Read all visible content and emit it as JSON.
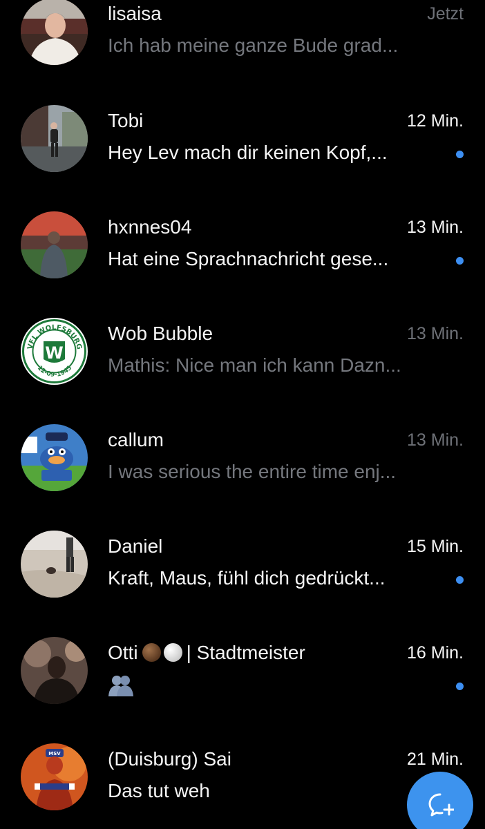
{
  "conversations": [
    {
      "name": "lisaisa",
      "time": "Jetzt",
      "preview": "Ich hab meine ganze Bude grad...",
      "unread": false,
      "avatar_icon": "man-in-stadium-avatar"
    },
    {
      "name": "Tobi",
      "time": "12 Min.",
      "preview": "Hey Lev mach dir keinen Kopf,...",
      "unread": true,
      "avatar_icon": "man-walking-street-avatar"
    },
    {
      "name": "hxnnes04",
      "time": "13 Min.",
      "preview": "Hat eine Sprachnachricht gese...",
      "unread": true,
      "avatar_icon": "man-in-stadium-crowd-avatar"
    },
    {
      "name": "Wob Bubble",
      "time": "13 Min.",
      "preview": "Mathis: Nice man ich kann Dazn...",
      "unread": false,
      "avatar_icon": "vfl-wolfsburg-logo-avatar",
      "avatar_text": {
        "top": "VFL WOLFSBURG",
        "bottom": "12-09-1945",
        "letter": "W"
      }
    },
    {
      "name": "callum",
      "time": "13 Min.",
      "preview": "I was serious the entire time enj...",
      "unread": false,
      "avatar_icon": "cartoon-fan-avatar"
    },
    {
      "name": "Daniel",
      "time": "15 Min.",
      "preview": "Kraft, Maus, fühl dich gedrückt...",
      "unread": true,
      "avatar_icon": "beach-dog-avatar"
    },
    {
      "name": "Otti",
      "name_suffix": "| Stadtmeister",
      "time": "16 Min.",
      "preview": "",
      "unread": true,
      "avatar_icon": "man-in-dark-avatar",
      "name_emojis": [
        "brown-circle-emoji",
        "white-circle-emoji"
      ],
      "preview_icon": "people-hugging-emoji"
    },
    {
      "name": "(Duisburg) Sai",
      "time": "21 Min.",
      "preview": "Das tut weh",
      "unread": false,
      "avatar_icon": "cartoon-msv-fan-avatar",
      "avatar_text": {
        "badge": "MSV"
      }
    }
  ],
  "fab": {
    "icon": "new-message-icon"
  },
  "colors": {
    "background": "#000000",
    "accent": "#3d93ee",
    "unread_dot": "#3d8ff2",
    "muted_text": "#74777d"
  }
}
